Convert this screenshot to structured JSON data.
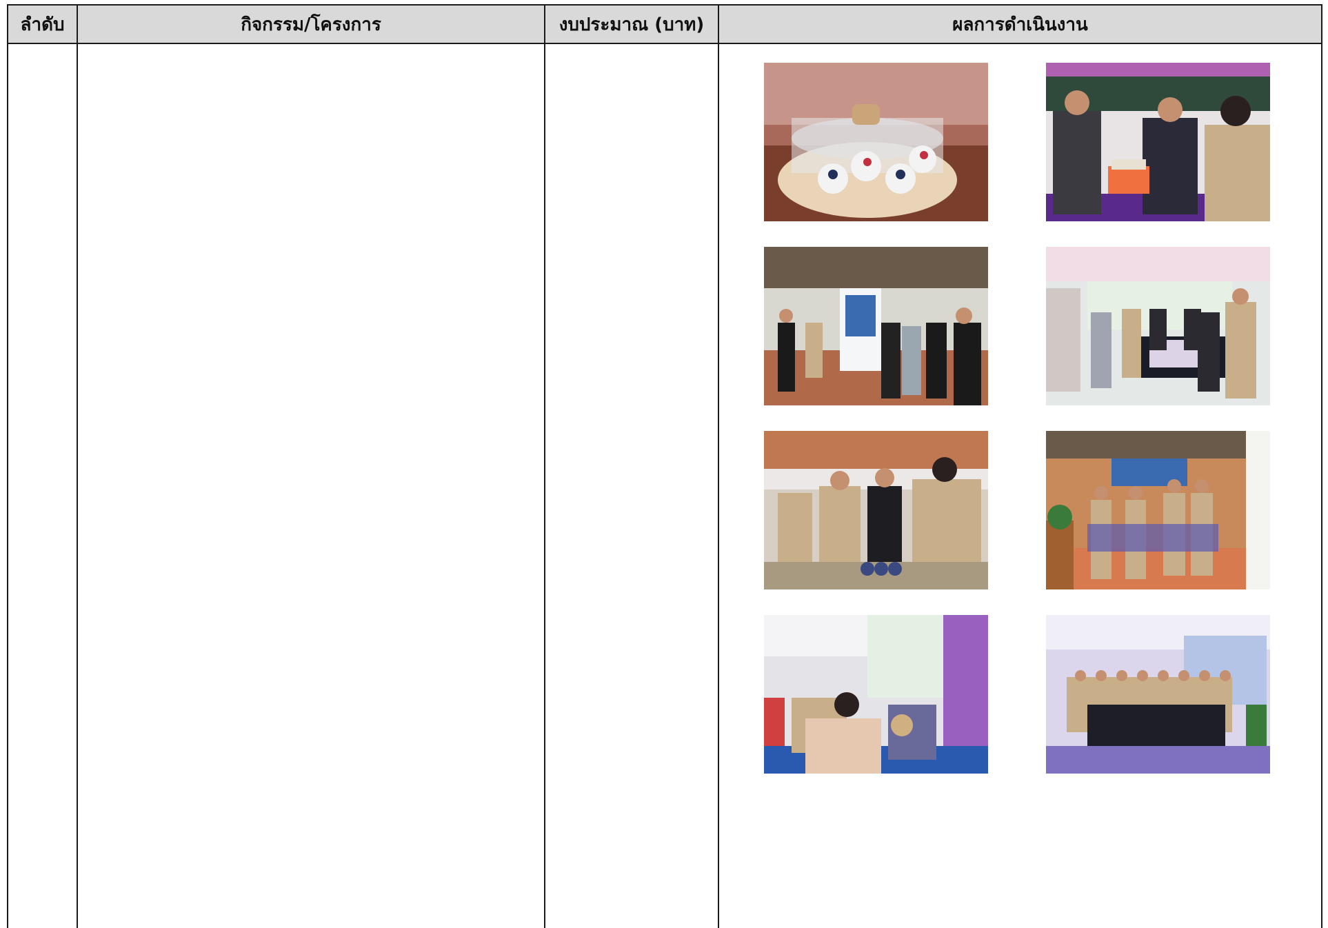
{
  "table": {
    "headers": {
      "order": "ลำดับ",
      "activity": "กิจกรรม/โครงการ",
      "budget": "งบประมาณ (บาท)",
      "result": "ผลการดำเนินงาน"
    }
  },
  "photos": [
    {
      "name": "photo-dessert-cups",
      "icon": "photo-icon"
    },
    {
      "name": "photo-officials-at-booth",
      "icon": "photo-icon"
    },
    {
      "name": "photo-visitors-at-milk-booth",
      "icon": "photo-icon"
    },
    {
      "name": "photo-group-at-exhibit-counter",
      "icon": "photo-icon"
    },
    {
      "name": "photo-officials-tasting",
      "icon": "photo-icon"
    },
    {
      "name": "photo-group-at-wood-booth",
      "icon": "photo-icon"
    },
    {
      "name": "photo-seated-officials",
      "icon": "photo-icon"
    },
    {
      "name": "photo-group-purple-hall",
      "icon": "photo-icon"
    }
  ]
}
